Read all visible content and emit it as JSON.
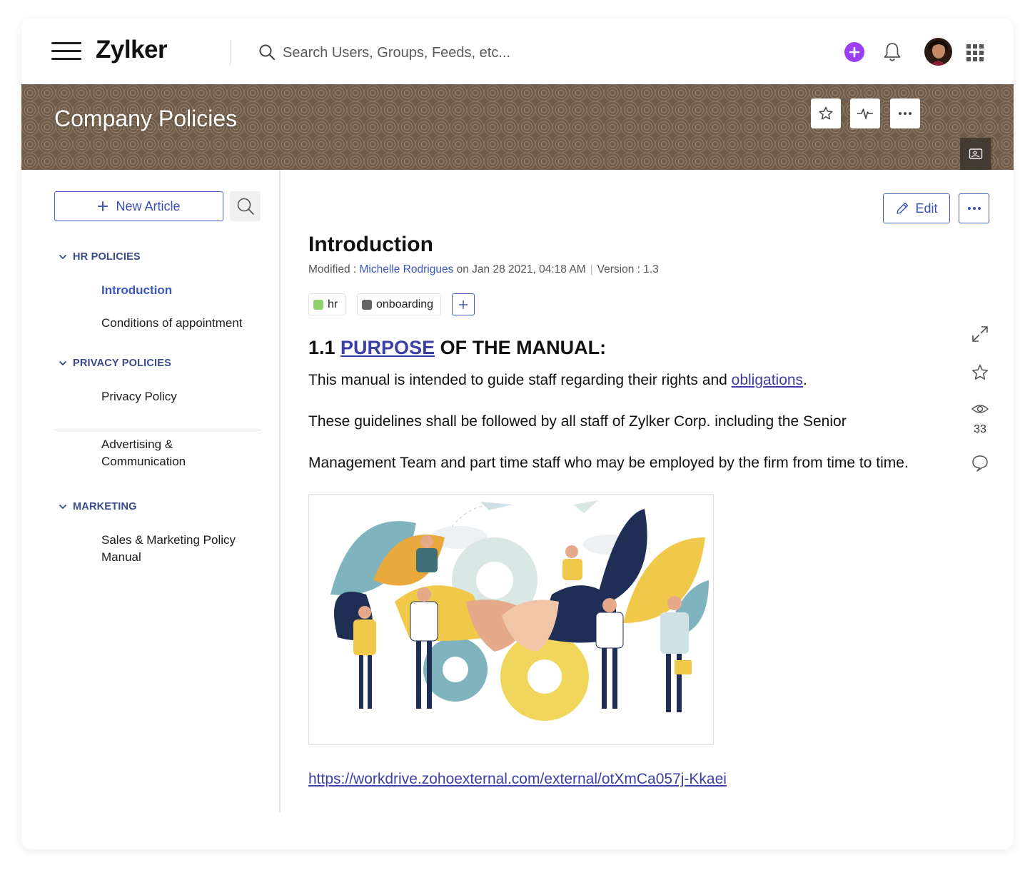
{
  "header": {
    "brand": "Zylker",
    "search_placeholder": "Search Users, Groups, Feeds, etc...",
    "accent": "#9b3ff5"
  },
  "banner": {
    "title": "Company Policies"
  },
  "sidebar": {
    "new_article_label": "New Article",
    "categories": [
      {
        "label": "HR POLICIES",
        "items": [
          "Introduction",
          "Conditions of appointment"
        ]
      },
      {
        "label": "PRIVACY POLICIES",
        "items": [
          "Privacy Policy",
          "Advertising & Communication"
        ]
      },
      {
        "label": "MARKETING",
        "items": [
          "Sales & Marketing Policy Manual"
        ]
      }
    ],
    "active_item": "Introduction"
  },
  "article": {
    "edit_label": "Edit",
    "title": "Introduction",
    "meta": {
      "modified_prefix": "Modified : ",
      "author": "Michelle Rodrigues",
      "date_text": " on Jan 28 2021, 04:18 AM",
      "version_text": "Version : 1.3"
    },
    "tags": [
      {
        "label": "hr",
        "color": "#8fd16a"
      },
      {
        "label": "onboarding",
        "color": "#666666"
      }
    ],
    "heading": {
      "prefix": "1.1 ",
      "link": "PURPOSE",
      "suffix": " OF THE MANUAL:"
    },
    "paragraphs": {
      "p1_text": "This manual is intended to guide staff regarding their rights and ",
      "p1_link": "obligations",
      "p1_end": ".",
      "p2": "These guidelines shall be followed by all staff of Zylker Corp. including the Senior",
      "p3": "Management Team and part time staff who may be employed by the firm from time to time."
    },
    "url": "https://workdrive.zohoexternal.com/external/otXmCa057j-Kkaei"
  },
  "rail": {
    "views": "33"
  },
  "colors": {
    "link": "#3b3fa6",
    "primary": "#3b4fb5",
    "category": "#3b4a8a",
    "banner": "#6f5c4a"
  }
}
